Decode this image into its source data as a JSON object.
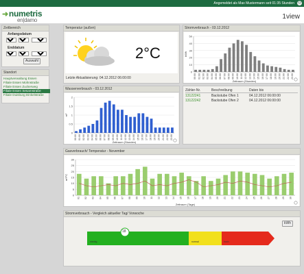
{
  "app": {
    "user_status": "Angemeldet als Max Mustermann seit 01:35 Stunden",
    "logo_main": "numetris",
    "logo_sub": "en|damo",
    "brand": "1view"
  },
  "zeitbereich": {
    "title": "Zeitbereich",
    "anfang_label": "Anfangsdatum",
    "anfang": {
      "day": "3",
      "month": "12",
      "year": "2012"
    },
    "end_label": "Enddatum",
    "ende": {
      "day": "4",
      "month": "12",
      "year": "2012"
    },
    "button": "Auswahl"
  },
  "standort": {
    "title": "Standort",
    "items": [
      {
        "label": "Hauptverwaltung Essen",
        "selected": false
      },
      {
        "label": "Filiale Essen Mohnstraße",
        "selected": false
      },
      {
        "label": "Filiale Essen Zuckerweg",
        "selected": false
      },
      {
        "label": "Filiale Essen Sesamstraße",
        "selected": true
      },
      {
        "label": "Filiale Duisburg Dinkelstraße",
        "selected": false
      }
    ]
  },
  "temperatur": {
    "title": "Temperatur (außen)",
    "value": "2°C",
    "updated": "Letzte Aktualisierung: 04.12.2012 06:00:00",
    "icon": "sun-cloud-icon"
  },
  "strom": {
    "title": "Stromverbrauch - 03.12.2012",
    "ylabel": "kWh",
    "xlabel": "Zeitraum (Stunden)"
  },
  "wasser": {
    "title": "Wasserverbrauch - 03.12.2012",
    "ylabel": "m³",
    "xlabel": "Zeitraum (Stunden)"
  },
  "zaehler": {
    "headers": [
      "Zähler-Nr.",
      "Beschreibung",
      "Daten bis"
    ],
    "rows": [
      {
        "nr": "13122241",
        "desc": "Backstube Ofen 1",
        "date": "04.12.2012 06:00:00"
      },
      {
        "nr": "13122242",
        "desc": "Backstube Ofen 2",
        "date": "04.12.2012 06:00:00"
      }
    ]
  },
  "gas": {
    "title": "Gasverbrauch/ Temperatur - November",
    "ylabel": "m³/°C",
    "xlabel": "Zeitraum (Tage)"
  },
  "vergleich": {
    "title": "Stromverbrauch - Vergleich aktueller Tag/ Vorwoche",
    "unit_button": "kWh",
    "marker_value": "18",
    "labels": [
      "niedrig",
      "normal",
      "hoch"
    ]
  },
  "chart_data": [
    {
      "type": "bar",
      "title": "Stromverbrauch - 03.12.2012",
      "xlabel": "Zeitraum (Stunden)",
      "ylabel": "kWh",
      "categories": [
        "00:00",
        "01:00",
        "02:00",
        "03:00",
        "04:00",
        "05:00",
        "06:00",
        "07:00",
        "08:00",
        "09:00",
        "10:00",
        "11:00",
        "12:00",
        "13:00",
        "14:00",
        "15:00",
        "16:00",
        "17:00",
        "18:00",
        "19:00",
        "20:00",
        "21:00",
        "22:00",
        "23:00"
      ],
      "values": [
        3,
        3,
        3,
        3,
        4,
        8,
        18,
        26,
        34,
        40,
        45,
        43,
        38,
        28,
        22,
        16,
        12,
        9,
        8,
        7,
        6,
        4,
        3,
        3
      ],
      "ylim": [
        0,
        50
      ],
      "ticks": [
        0,
        10,
        20,
        30,
        40,
        50
      ],
      "color": "#7f7f7f"
    },
    {
      "type": "bar",
      "title": "Wasserverbrauch - 03.12.2012",
      "xlabel": "Zeitraum (Stunden)",
      "ylabel": "m³",
      "categories": [
        "00:00",
        "01:00",
        "02:00",
        "03:00",
        "04:00",
        "05:00",
        "06:00",
        "07:00",
        "08:00",
        "09:00",
        "10:00",
        "11:00",
        "12:00",
        "13:00",
        "14:00",
        "15:00",
        "16:00",
        "17:00",
        "18:00",
        "19:00",
        "20:00",
        "21:00",
        "22:00",
        "23:00"
      ],
      "values": [
        0.1,
        0.2,
        0.3,
        0.4,
        0.5,
        0.7,
        1.4,
        1.7,
        1.8,
        1.6,
        1.3,
        1.3,
        1.0,
        0.9,
        0.9,
        1.1,
        1.1,
        0.9,
        0.8,
        0.3,
        0.3,
        0.3,
        0.3,
        0.3
      ],
      "ylim": [
        0,
        2
      ],
      "ticks": [
        0,
        0.5,
        1,
        1.5,
        2
      ],
      "color": "#2f5fd0"
    },
    {
      "type": "bar",
      "title": "Gasverbrauch/ Temperatur - November",
      "xlabel": "Zeitraum (Tage)",
      "ylabel": "m³/°C",
      "categories": [
        "01",
        "02",
        "03",
        "04",
        "05",
        "06",
        "07",
        "08",
        "09",
        "10",
        "11",
        "12",
        "13",
        "14",
        "15",
        "16",
        "17",
        "18",
        "19",
        "20",
        "21",
        "22",
        "23",
        "24",
        "25",
        "26",
        "27",
        "28",
        "29",
        "30"
      ],
      "series": [
        {
          "values": [
            18,
            14,
            16,
            16,
            10,
            16,
            16,
            18,
            22,
            24,
            14,
            18,
            18,
            16,
            19,
            16,
            12,
            16,
            12,
            14,
            17,
            20,
            20,
            19,
            18,
            17,
            14,
            16,
            18,
            19
          ],
          "color": "#9acd6e"
        },
        {
          "values": [
            10,
            8,
            7,
            8,
            9,
            8,
            10,
            9,
            10,
            12,
            8,
            9,
            8,
            10,
            11,
            13,
            11,
            7,
            8,
            9,
            11,
            10,
            12,
            11,
            9,
            8,
            7,
            8,
            10,
            11
          ],
          "color": "#c0504d"
        }
      ],
      "ylim": [
        0,
        30
      ],
      "ticks": [
        0,
        5,
        10,
        15,
        20,
        25,
        30
      ]
    }
  ]
}
